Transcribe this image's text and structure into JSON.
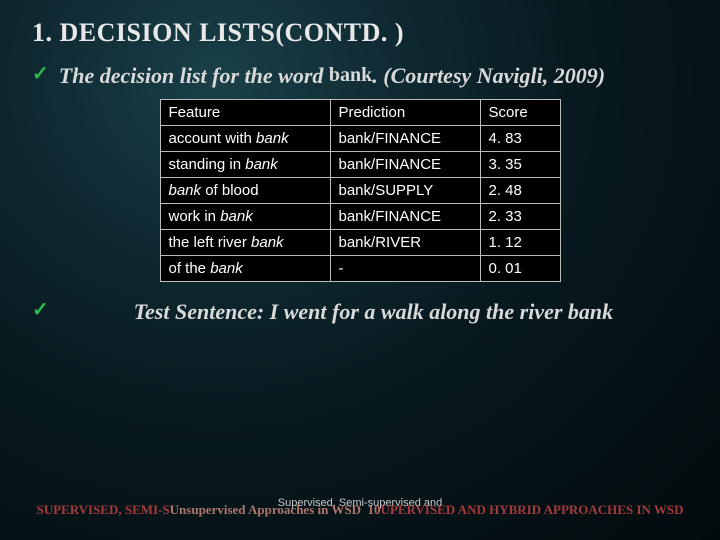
{
  "title": "1. DECISION LISTS(CONTD. )",
  "bullet1_pre": "The decision list for the word ",
  "bullet1_word": "bank",
  "bullet1_post": ". (Courtesy Navigli, 2009)",
  "table": {
    "headers": [
      "Feature",
      "Prediction",
      "Score"
    ],
    "rows": [
      {
        "f_pre": "account with  ",
        "f_it": "bank",
        "p": "bank/FINANCE",
        "s": "4. 83"
      },
      {
        "f_pre": "standing in ",
        "f_it": "bank",
        "p": "bank/FINANCE",
        "s": "3. 35"
      },
      {
        "f_pre_it": "bank",
        "f_post": " of blood",
        "p": "bank/SUPPLY",
        "s": "2. 48"
      },
      {
        "f_pre": "work in  ",
        "f_it": "bank",
        "p": "bank/FINANCE",
        "s": "2. 33"
      },
      {
        "f_pre": "the left river ",
        "f_it": "bank",
        "p": "bank/RIVER",
        "s": "1. 12"
      },
      {
        "f_pre": "of the  ",
        "f_it": "bank",
        "p": "-",
        "s": "0. 01"
      }
    ]
  },
  "bullet2": "Test Sentence: I went for a walk along the river bank",
  "footer_small": "Supervised, Semi-supervised and",
  "footer_main_left": "SUPERVISED, SEMI-S",
  "footer_overlap": "Unsupervised Approaches in WSD  10",
  "footer_main_right": "UPERVISED AND HYBRID APPROACHES IN WSD"
}
